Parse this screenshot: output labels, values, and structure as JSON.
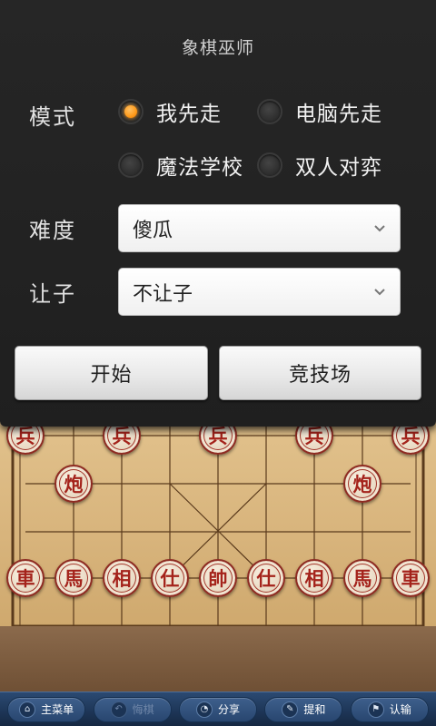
{
  "dialog": {
    "title": "象棋巫师",
    "mode_label": "模式",
    "mode_options": [
      {
        "label": "我先走",
        "checked": true
      },
      {
        "label": "电脑先走",
        "checked": false
      },
      {
        "label": "魔法学校",
        "checked": false
      },
      {
        "label": "双人对弈",
        "checked": false
      }
    ],
    "difficulty_label": "难度",
    "difficulty_value": "傻瓜",
    "handicap_label": "让子",
    "handicap_value": "不让子",
    "start_button": "开始",
    "arena_button": "竞技场"
  },
  "board": {
    "soldier_row": [
      "兵",
      "兵",
      "兵",
      "兵",
      "兵"
    ],
    "cannon_row": [
      "炮",
      "炮"
    ],
    "back_row": [
      "車",
      "馬",
      "相",
      "仕",
      "帥",
      "仕",
      "相",
      "馬",
      "車"
    ]
  },
  "toolbar": {
    "main_menu": "主菜单",
    "undo": "悔棋",
    "share": "分享",
    "draw": "提和",
    "resign": "认输",
    "icons": [
      "home-icon",
      "undo-icon",
      "share-icon",
      "draw-icon",
      "flag-icon"
    ]
  },
  "colors": {
    "accent": "#ff9a1a",
    "piece_red": "#a4231b",
    "dialog_bg": "#232323",
    "toolbar_bg": "#1e3658"
  }
}
